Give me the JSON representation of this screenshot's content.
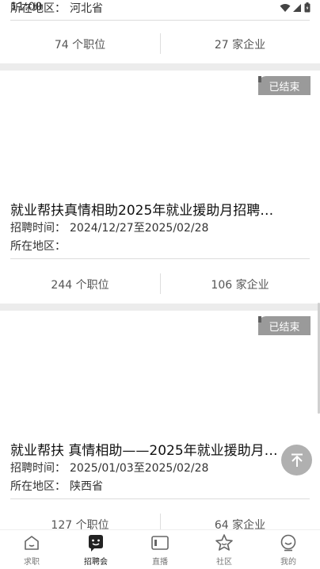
{
  "status_bar": {
    "time": "11:00"
  },
  "cards": [
    {
      "region_label": "所在地区：",
      "region_value": "河北省",
      "positions": "74 个职位",
      "companies": "27 家企业"
    },
    {
      "badge": "已结束",
      "title": "就业帮扶真情相助2025年就业援助月招聘…",
      "time_label": "招聘时间：",
      "time_value": "2024/12/27至2025/02/28",
      "region_label": "所在地区：",
      "region_value": "",
      "positions": "244 个职位",
      "companies": "106 家企业"
    },
    {
      "badge": "已结束",
      "title": "就业帮扶 真情相助——2025年就业援助月…",
      "time_label": "招聘时间：",
      "time_value": "2025/01/03至2025/02/28",
      "region_label": "所在地区：",
      "region_value": "陕西省",
      "positions": "127 个职位",
      "companies": "64 家企业"
    }
  ],
  "bottom_nav": {
    "items": [
      {
        "label": "求职",
        "icon": "home-icon"
      },
      {
        "label": "招聘会",
        "icon": "chat-bubble-icon"
      },
      {
        "label": "直播",
        "icon": "video-icon"
      },
      {
        "label": "社区",
        "icon": "star-icon"
      },
      {
        "label": "我的",
        "icon": "profile-icon"
      }
    ],
    "active_index": 1
  },
  "colors": {
    "badge": "#9a9a9a",
    "background": "#ececec",
    "active_nav": "#222222"
  }
}
